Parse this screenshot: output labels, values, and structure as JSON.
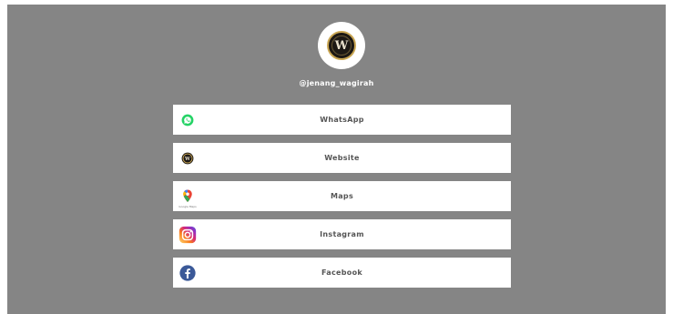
{
  "profile": {
    "avatar_letter": "W",
    "username": "@jenang_wagirah"
  },
  "links": [
    {
      "label": "WhatsApp",
      "icon": "whatsapp-icon",
      "color": "#25d366"
    },
    {
      "label": "Website",
      "icon": "website-logo-icon",
      "color": "#1c1814"
    },
    {
      "label": "Maps",
      "icon": "google-maps-icon",
      "color": "#ea4335",
      "icon_caption": "Google Maps"
    },
    {
      "label": "Instagram",
      "icon": "instagram-icon",
      "color": "#c13584"
    },
    {
      "label": "Facebook",
      "icon": "facebook-icon",
      "color": "#3b5998"
    }
  ],
  "colors": {
    "background": "#858585",
    "button": "#ffffff",
    "button_text": "#555555"
  }
}
